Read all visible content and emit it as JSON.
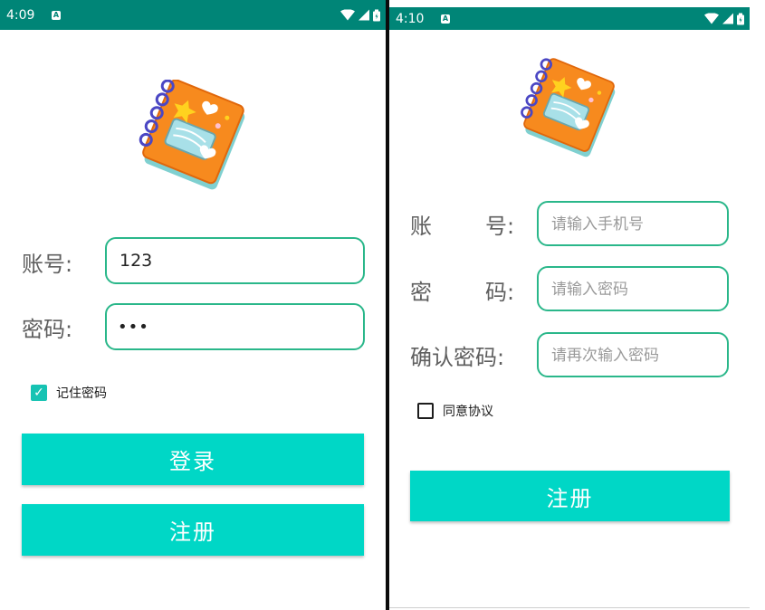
{
  "colors": {
    "statusbar": "#008577",
    "accent": "#00d7c6",
    "field_border": "#2ab78a"
  },
  "login": {
    "status_time": "4:09",
    "status_a": "A",
    "account_label": "账号:",
    "account_value": "123",
    "password_label": "密码:",
    "password_value": "•••",
    "remember_label": "记住密码",
    "remember_checked": true,
    "login_button": "登录",
    "register_button": "注册"
  },
  "register": {
    "status_time": "4:10",
    "status_a": "A",
    "account_label_1": "账",
    "account_label_2": "号:",
    "account_placeholder": "请输入手机号",
    "password_label_1": "密",
    "password_label_2": "码:",
    "password_placeholder": "请输入密码",
    "confirm_label": "确认密码:",
    "confirm_placeholder": "请再次输入密码",
    "agree_label": "同意协议",
    "agree_checked": false,
    "register_button": "注册"
  }
}
